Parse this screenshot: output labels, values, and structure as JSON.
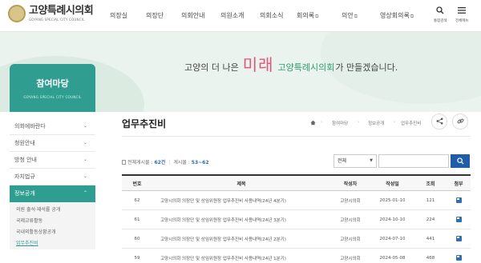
{
  "header": {
    "logo_text": "고양특례시의회",
    "logo_sub": "GOYANG SPECIAL CITY COUNCIL",
    "nav": [
      {
        "label": "의장실",
        "external": false
      },
      {
        "label": "의장단",
        "external": false
      },
      {
        "label": "의회안내",
        "external": false
      },
      {
        "label": "의원소개",
        "external": false
      },
      {
        "label": "의회소식",
        "external": false
      },
      {
        "label": "회의록",
        "external": true
      },
      {
        "label": "의안",
        "external": true
      },
      {
        "label": "영상회의록",
        "external": true
      }
    ],
    "external_mark": "⧉",
    "util_search_label": "통합검색",
    "util_menu_label": "전체메뉴"
  },
  "banner": {
    "slogan_pre": "고양의 더 나은",
    "slogan_highlight": "미래",
    "slogan_name": "고양특례시의회",
    "slogan_post": "가 만들겠습니다."
  },
  "sidebar": {
    "title": "참여마당",
    "title_en": "GOYANG SPECIAL CITY COUNCIL",
    "items": [
      {
        "label": "의회에바란다",
        "active": false
      },
      {
        "label": "청원안내",
        "active": false
      },
      {
        "label": "방청 안내",
        "active": false
      },
      {
        "label": "자치법규",
        "active": false
      },
      {
        "label": "정보공개",
        "active": true
      }
    ],
    "subitems": [
      {
        "label": "의원 출석·재석률 공개",
        "current": false
      },
      {
        "label": "국제교류활동",
        "current": false
      },
      {
        "label": "국내외활동상황공개",
        "current": false
      },
      {
        "label": "업무추진비",
        "current": true
      }
    ]
  },
  "content": {
    "title": "업무추진비",
    "breadcrumb": [
      "참여마당",
      "정보공개",
      "업무추진비"
    ],
    "count_label": "전체게시물 :",
    "count_value": "62건",
    "page_label": "게시물 :",
    "page_value": "53~62",
    "search_select": "전체",
    "search_placeholder": ""
  },
  "table": {
    "headers": {
      "num": "번호",
      "title": "제목",
      "author": "작성자",
      "date": "작성일",
      "views": "조회",
      "attach": "첨부"
    },
    "rows": [
      {
        "num": "62",
        "title": "고양시의회 의장단 및 상임위원장 업무추진비 사용내역(24년 4분기)",
        "author": "고양시의회",
        "date": "2025-01-10",
        "views": "121",
        "attach": true
      },
      {
        "num": "61",
        "title": "고양시의회 의장단 및 상임위원장 업무추진비 사용내역(24년 3분기)",
        "author": "고양시의회",
        "date": "2024-10-10",
        "views": "224",
        "attach": true
      },
      {
        "num": "60",
        "title": "고양시의회 의장단 및 상임위원장 업무추진비 사용내역(24년 2분기)",
        "author": "고양시의회",
        "date": "2024-07-10",
        "views": "441",
        "attach": true
      },
      {
        "num": "59",
        "title": "고양시의회 의장단 및 상임위원장 업무추진비 사용내역(24년 1분기)",
        "author": "고양시의회",
        "date": "2024-05-08",
        "views": "468",
        "attach": true
      }
    ]
  },
  "colors": {
    "accent": "#2f9e91",
    "primary": "#1f5da8",
    "highlight": "#e0557a"
  }
}
